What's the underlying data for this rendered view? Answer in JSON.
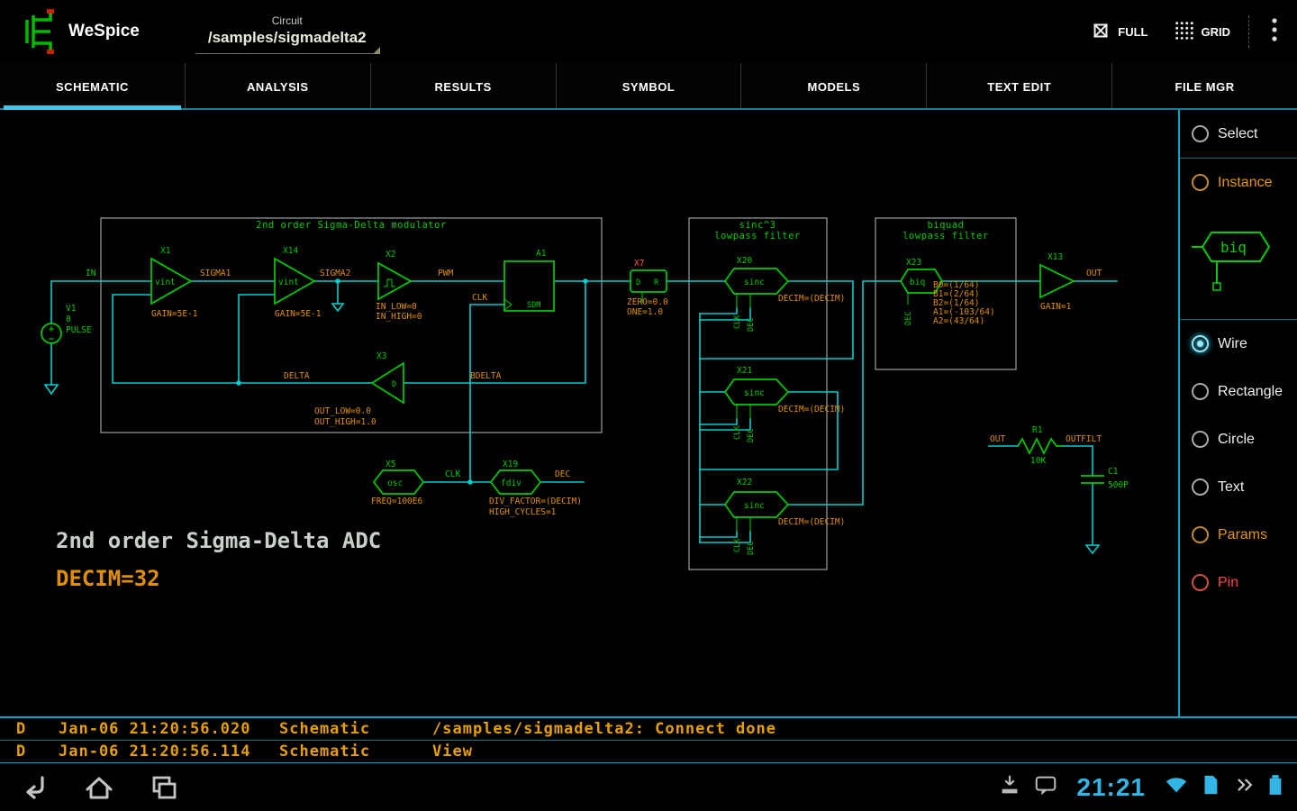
{
  "app_bar": {
    "title": "WeSpice",
    "spinner_label": "Circuit",
    "spinner_value": "/samples/sigmadelta2",
    "actions": {
      "full": "FULL",
      "grid": "GRID"
    }
  },
  "tabs": [
    {
      "label": "SCHEMATIC",
      "selected": true
    },
    {
      "label": "ANALYSIS"
    },
    {
      "label": "RESULTS"
    },
    {
      "label": "SYMBOL"
    },
    {
      "label": "MODELS"
    },
    {
      "label": "TEXT EDIT"
    },
    {
      "label": "FILE MGR"
    }
  ],
  "palette": {
    "select": "Select",
    "instance": "Instance",
    "preview_symbol": "biq",
    "wire": "Wire",
    "rectangle": "Rectangle",
    "circle": "Circle",
    "text": "Text",
    "params": "Params",
    "pin": "Pin",
    "selected_tool": "Wire"
  },
  "schematic": {
    "annotations": {
      "title": "2nd order Sigma-Delta ADC",
      "decim": "DECIM=32"
    },
    "boxes": {
      "modulator": "2nd order Sigma-Delta modulator",
      "sinc_line1": "sinc^3",
      "sinc_line2": "lowpass filter",
      "biquad_line1": "biquad",
      "biquad_line2": "lowpass filter"
    },
    "nets": {
      "in": "IN",
      "sigma1": "SIGMA1",
      "sigma2": "SIGMA2",
      "pwm": "PWM",
      "clk": "CLK",
      "dec": "DEC",
      "delta": "DELTA",
      "bdelta": "BDELTA",
      "out": "OUT",
      "outfilt": "OUTFILT",
      "sdm": "SDM"
    },
    "v1": {
      "name": "V1",
      "value": "0",
      "model": "PULSE"
    },
    "x1": {
      "name": "X1",
      "type": "vint",
      "param": "GAIN=5E-1"
    },
    "x14": {
      "name": "X14",
      "type": "vint",
      "param": "GAIN=5E-1"
    },
    "x2": {
      "name": "X2",
      "param1": "IN_LOW=0",
      "param2": "IN_HIGH=0"
    },
    "a1": {
      "name": "A1",
      "clk": "CLK"
    },
    "x7": {
      "name": "X7",
      "pin_left": "D",
      "pin_right": "R",
      "param1": "ZERO=0.0",
      "param2": "ONE=1.0"
    },
    "x3": {
      "name": "X3",
      "pin": "D",
      "param1": "OUT_LOW=0.0",
      "param2": "OUT_HIGH=1.0"
    },
    "x5": {
      "name": "X5",
      "type": "osc",
      "out": "CLK",
      "param": "FREQ=100E6"
    },
    "x19": {
      "name": "X19",
      "type": "fdiv",
      "out": "DEC",
      "param1": "DIV_FACTOR=(DECIM)",
      "param2": "HIGH_CYCLES=1"
    },
    "x20": {
      "name": "X20",
      "type": "sinc",
      "param": "DECIM=(DECIM)",
      "pin1": "CLK",
      "pin2": "DEC"
    },
    "x21": {
      "name": "X21",
      "type": "sinc",
      "param": "DECIM=(DECIM)",
      "pin1": "CLK",
      "pin2": "DEC"
    },
    "x22": {
      "name": "X22",
      "type": "sinc",
      "param": "DECIM=(DECIM)",
      "pin1": "CLK",
      "pin2": "DEC"
    },
    "x23": {
      "name": "X23",
      "type": "biq",
      "pin": "DEC",
      "b0": "B0=(1/64)",
      "b1": "B1=(2/64)",
      "b2": "B2=(1/64)",
      "a1": "A1=(-103/64)",
      "a2": "A2=(43/64)"
    },
    "x13": {
      "name": "X13",
      "param": "GAIN=1"
    },
    "r1": {
      "name": "R1",
      "value": "10K"
    },
    "c1": {
      "name": "C1",
      "value": "500P"
    }
  },
  "log": {
    "rows": [
      {
        "level": "D",
        "time": "Jan-06 21:20:56.020",
        "source": "Schematic",
        "message": "/samples/sigmadelta2: Connect done"
      },
      {
        "level": "D",
        "time": "Jan-06 21:20:56.114",
        "source": "Schematic",
        "message": "View"
      }
    ]
  },
  "status_bar": {
    "clock": "21:21"
  },
  "colors": {
    "accent": "#33b5e5",
    "wire": "#00cdcd",
    "component": "#00cc00",
    "param": "#e08f00",
    "pin_red": "#ff4444"
  }
}
